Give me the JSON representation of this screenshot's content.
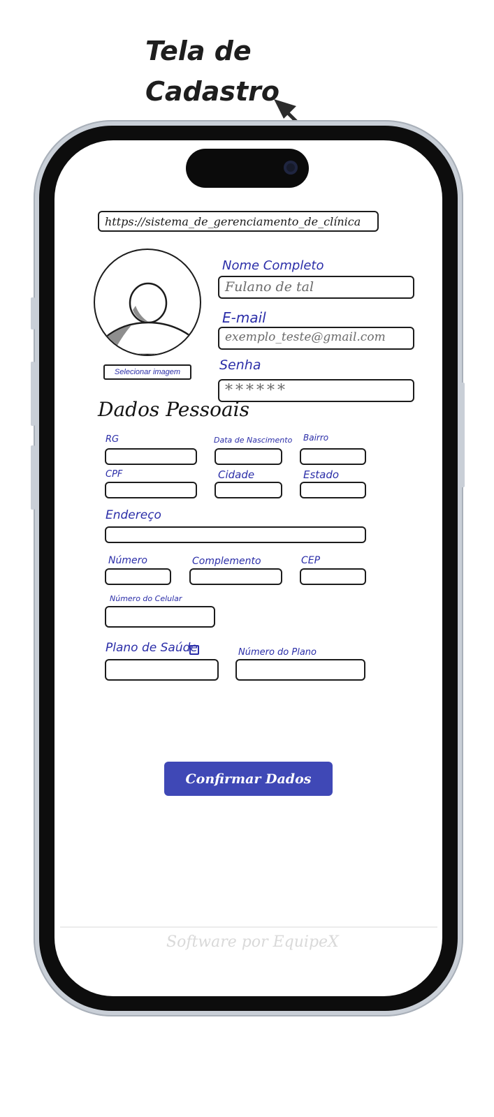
{
  "annotation": {
    "title": "Tela de\nCadastro"
  },
  "browser": {
    "url": "https://sistema_de_gerenciamento_de_clínica"
  },
  "profile": {
    "select_image_label": "Selecionar imagem"
  },
  "account": {
    "name_label": "Nome Completo",
    "name_value": "Fulano de tal",
    "email_label": "E-mail",
    "email_value": "exemplo_teste@gmail.com",
    "password_label": "Senha",
    "password_value": "******"
  },
  "personal": {
    "section_title": "Dados Pessoais",
    "rg_label": "RG",
    "birth_label": "Data de Nascimento",
    "bairro_label": "Bairro",
    "cpf_label": "CPF",
    "cidade_label": "Cidade",
    "estado_label": "Estado",
    "endereco_label": "Endereço",
    "numero_label": "Número",
    "complemento_label": "Complemento",
    "cep_label": "CEP",
    "celular_label": "Número do Celular",
    "plano_label": "Plano de Saúde",
    "numero_plano_label": "Número do Plano"
  },
  "actions": {
    "confirm_label": "Confirmar Dados"
  },
  "footer": {
    "credit": "Software por EquipeX"
  },
  "colors": {
    "accent": "#3f48b6",
    "label_ink": "#2b2ea8"
  }
}
